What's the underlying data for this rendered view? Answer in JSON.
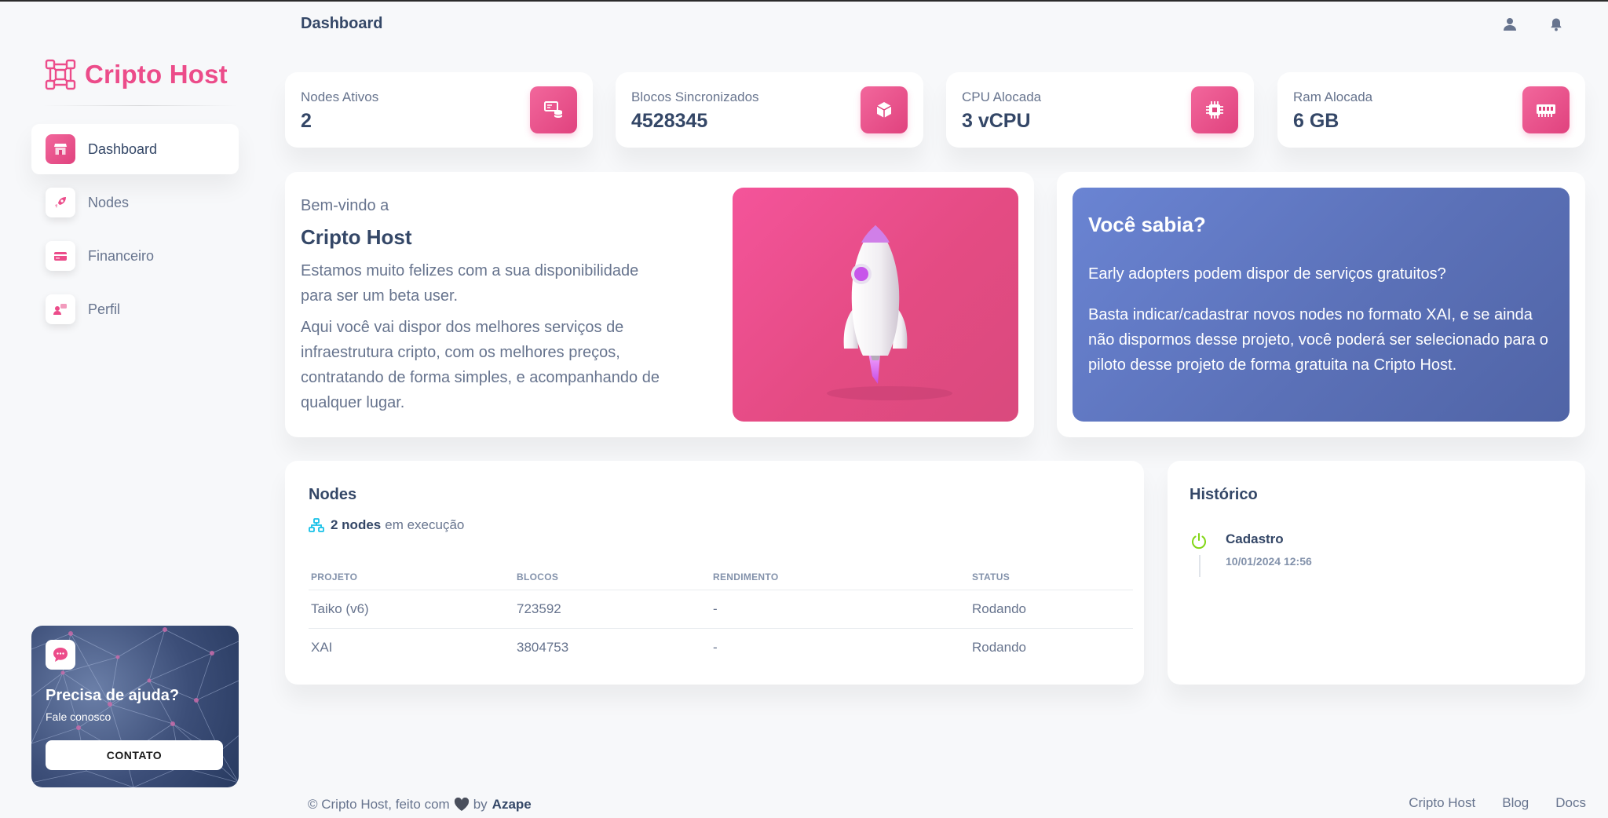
{
  "brand": {
    "name": "Cripto Host"
  },
  "header": {
    "title": "Dashboard",
    "user_icon": "user-icon",
    "bell_icon": "bell-icon"
  },
  "sidebar": {
    "items": [
      {
        "label": "Dashboard",
        "icon": "store-icon",
        "active": true
      },
      {
        "label": "Nodes",
        "icon": "rocket-icon",
        "active": false
      },
      {
        "label": "Financeiro",
        "icon": "credit-card-icon",
        "active": false
      },
      {
        "label": "Perfil",
        "icon": "user-chat-icon",
        "active": false
      }
    ],
    "help": {
      "title": "Precisa de ajuda?",
      "subtitle": "Fale conosco",
      "button": "CONTATO",
      "icon": "chat-bubble-icon"
    }
  },
  "stats": [
    {
      "label": "Nodes Ativos",
      "value": "2",
      "icon": "database-icon"
    },
    {
      "label": "Blocos Sincronizados",
      "value": "4528345",
      "icon": "cube-icon"
    },
    {
      "label": "CPU Alocada",
      "value": "3 vCPU",
      "icon": "cpu-icon"
    },
    {
      "label": "Ram Alocada",
      "value": "6 GB",
      "icon": "memory-icon"
    }
  ],
  "welcome": {
    "pre": "Bem-vindo a",
    "title": "Cripto Host",
    "p1": "Estamos muito felizes com a sua disponibilidade para ser um beta user.",
    "p2": "Aqui você vai dispor dos melhores serviços de infraestrutura cripto, com os melhores preços, contratando de forma simples, e acompanhando de qualquer lugar."
  },
  "did_you_know": {
    "title": "Você sabia?",
    "p1": "Early adopters podem dispor de serviços gratuitos?",
    "p2": "Basta indicar/cadastrar novos nodes no formato XAI, e se ainda não dispormos desse projeto, você poderá ser selecionado para o piloto desse projeto de forma gratuita na Cripto Host."
  },
  "nodes": {
    "title": "Nodes",
    "count_bold": "2 nodes",
    "count_rest": "em execução",
    "columns": [
      "PROJETO",
      "BLOCOS",
      "RENDIMENTO",
      "STATUS"
    ],
    "rows": [
      [
        "Taiko (v6)",
        "723592",
        "-",
        "Rodando"
      ],
      [
        "XAI",
        "3804753",
        "-",
        "Rodando"
      ]
    ]
  },
  "history": {
    "title": "Histórico",
    "items": [
      {
        "name": "Cadastro",
        "date": "10/01/2024 12:56",
        "icon": "power-icon"
      }
    ]
  },
  "footer": {
    "left_text": "© Cripto Host, feito com",
    "by": "by",
    "author": "Azape",
    "links": [
      "Cripto Host",
      "Blog",
      "Docs"
    ]
  },
  "colors": {
    "accent": "#ec4c8a",
    "info_card": "#5b71b8",
    "text_dark": "#344767",
    "text_muted": "#67748e",
    "success": "#82d616"
  }
}
